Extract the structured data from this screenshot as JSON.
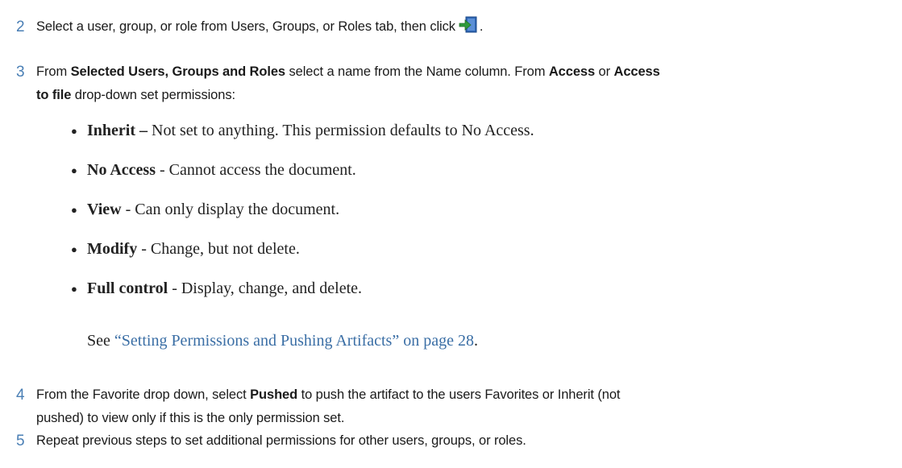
{
  "steps": [
    {
      "number": "2",
      "text_before_icon": "Select a user, group, or role from Users, Groups, or Roles tab, then click",
      "text_after_icon": ".",
      "icon": "add-arrow-icon"
    },
    {
      "number": "3",
      "part1": "From ",
      "bold1": "Selected Users, Groups and Roles",
      "part2": " select a name from the Name column. From ",
      "bold2": "Access",
      "part3": " or ",
      "bold3": "Access",
      "bold4": "to file",
      "part4": " drop-down set permissions:"
    },
    {
      "number": "4",
      "part1": "From the Favorite drop down, select ",
      "bold1": "Pushed",
      "part2": " to push the artifact to the users Favorites or Inherit (not",
      "line2": "pushed) to view only if this is the only permission set."
    },
    {
      "number": "5",
      "text": "Repeat previous steps to set additional permissions for other users, groups, or roles."
    }
  ],
  "permissions": [
    {
      "term": "Inherit",
      "separator": " – ",
      "description": "Not set to anything. This permission defaults to No Access."
    },
    {
      "term": "No Access",
      "separator": " - ",
      "description": "Cannot access the document."
    },
    {
      "term": "View",
      "separator": " - ",
      "description": "Can only display the document."
    },
    {
      "term": "Modify",
      "separator": " - ",
      "description": "Change, but not delete."
    },
    {
      "term": "Full control",
      "separator": " - ",
      "description": "Display, change, and delete."
    }
  ],
  "see_also": {
    "prefix": "See ",
    "link_text": "“Setting Permissions and Pushing Artifacts” on page 28",
    "suffix": "."
  },
  "colors": {
    "step_number": "#4a7fb5",
    "link": "#3a6ea5",
    "icon_blue": "#2f66b3",
    "icon_green": "#2e9b3a"
  }
}
